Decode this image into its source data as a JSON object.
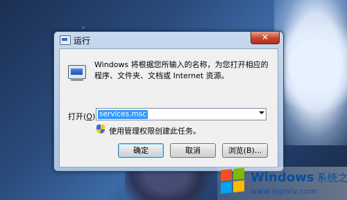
{
  "dialog": {
    "title": "运行",
    "close_label": "✕",
    "description": "Windows 将根据您所输入的名称，为您打开相应的程序、文件夹、文档或 Internet 资源。",
    "open_label_prefix": "打开(",
    "open_label_hotkey": "O",
    "open_label_suffix": "):",
    "command_value": "services.msc",
    "admin_note": "使用管理权限创建此任务。",
    "ok_label": "确定",
    "cancel_label": "取消",
    "browse_label": "浏览(B)..."
  },
  "watermark": {
    "brand": "Windows",
    "brand_cn": "系统之家",
    "url": "www.bjjmlv.com"
  },
  "icons": {
    "title": "run-window-icon",
    "run": "run-program-icon",
    "shield": "uac-shield-icon",
    "dropdown": "chevron-down-icon",
    "logo": "windows-logo-icon"
  }
}
